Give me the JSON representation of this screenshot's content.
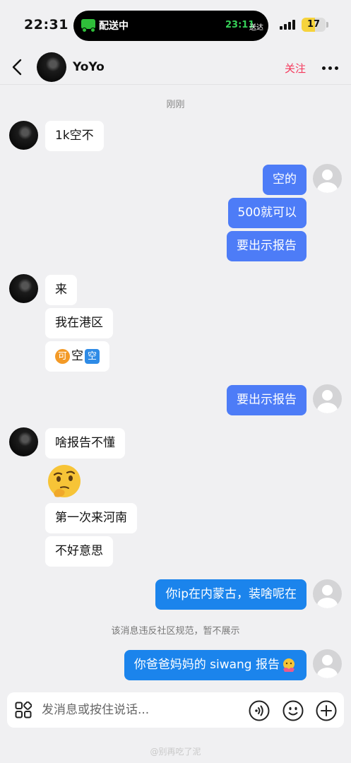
{
  "status_bar": {
    "time": "22:31",
    "island_label": "配送中",
    "island_eta": "23:11",
    "island_eta_suffix": "送达",
    "battery": "17"
  },
  "header": {
    "name": "YoYo",
    "follow_label": "关注"
  },
  "timestamp": "刚刚",
  "messages": {
    "m1": "1k空不",
    "m2": "空的",
    "m3": "500就可以",
    "m4": "要出示报告",
    "m5": "来",
    "m6": "我在港区",
    "m7_circle": "可",
    "m7_text": "空",
    "m7_square": "空",
    "m8": "要出示报告",
    "m9": "啥报告不懂",
    "m10": "第一次来河南",
    "m11": "不好意思",
    "m12": "你ip在内蒙古，装啥呢在",
    "m13": "你爸爸妈妈的 siwang 报告"
  },
  "system_note": "该消息违反社区规范，暂不展示",
  "input": {
    "placeholder": "发消息或按住说话..."
  },
  "watermark": "@别再吃了泥",
  "icons": [
    "back-icon",
    "more-icon",
    "apps-icon",
    "voice-icon",
    "emoji-icon",
    "plus-icon",
    "thinking-emoji-icon",
    "hug-emoji-icon"
  ],
  "colors": {
    "outgoing_bubble": "#4d7cf7",
    "outgoing_bubble_alt": "#1b84ec",
    "follow": "#f5375b",
    "background": "#f0f0f2"
  }
}
